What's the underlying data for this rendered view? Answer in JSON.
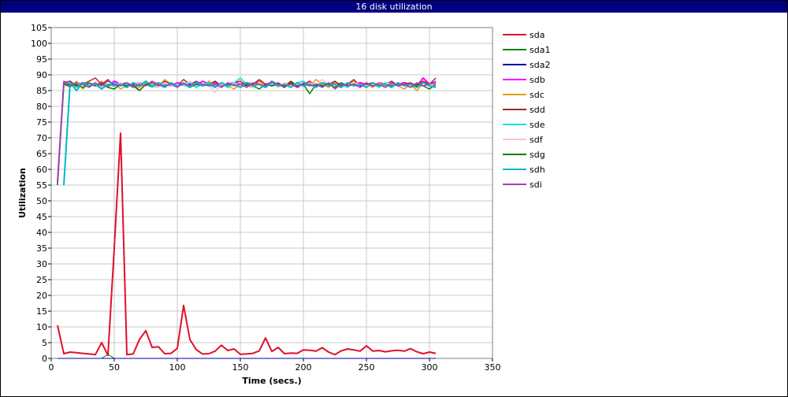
{
  "window": {
    "title": "16 disk utilization"
  },
  "chart_data": {
    "type": "line",
    "title": "16 disk utilization",
    "xlabel": "Time (secs.)",
    "ylabel": "Utilization",
    "xlim": [
      0,
      350
    ],
    "ylim": [
      0,
      105
    ],
    "xticks": [
      0,
      50,
      100,
      150,
      200,
      250,
      300,
      350
    ],
    "yticks": [
      0,
      5,
      10,
      15,
      20,
      25,
      30,
      35,
      40,
      45,
      50,
      55,
      60,
      65,
      70,
      75,
      80,
      85,
      90,
      95,
      100,
      105
    ],
    "grid": true,
    "legend_position": "right",
    "x": [
      5,
      10,
      15,
      20,
      25,
      30,
      35,
      40,
      45,
      50,
      55,
      60,
      65,
      70,
      75,
      80,
      85,
      90,
      95,
      100,
      105,
      110,
      115,
      120,
      125,
      130,
      135,
      140,
      145,
      150,
      155,
      160,
      165,
      170,
      175,
      180,
      185,
      190,
      195,
      200,
      205,
      210,
      215,
      220,
      225,
      230,
      235,
      240,
      245,
      250,
      255,
      260,
      265,
      270,
      275,
      280,
      285,
      290,
      295,
      300,
      305
    ],
    "series": [
      {
        "name": "sda",
        "color": "#e0102a",
        "width": 2,
        "values": [
          10.5,
          1.5,
          2,
          1.8,
          1.6,
          1.4,
          1.2,
          5,
          1,
          35,
          71.5,
          1.2,
          1.4,
          6,
          8.8,
          3.5,
          3.7,
          1.5,
          1.6,
          3.2,
          16.8,
          6,
          2.8,
          1.4,
          1.5,
          2.3,
          4.2,
          2.5,
          3,
          1.3,
          1.4,
          1.6,
          2.4,
          6.5,
          2.2,
          3.5,
          1.5,
          1.7,
          1.6,
          2.7,
          2.6,
          2.3,
          3.4,
          2,
          1.2,
          2.4,
          3,
          2.7,
          2.3,
          4,
          2.3,
          2.5,
          2.1,
          2.4,
          2.6,
          2.3,
          3.1,
          2.1,
          1.5,
          2,
          1.6
        ]
      },
      {
        "name": "sda1",
        "color": "#008000",
        "width": 1,
        "values": [
          0,
          0,
          0,
          0,
          0,
          0,
          0,
          0,
          1.3,
          0,
          0,
          0,
          0,
          0,
          0,
          0,
          0,
          0,
          0,
          0,
          0,
          0,
          0,
          0,
          0,
          0,
          0,
          0,
          0,
          0,
          0,
          0,
          0,
          0,
          0,
          0,
          0,
          0,
          0,
          0,
          0,
          0,
          0,
          0,
          0,
          0,
          0,
          0,
          0,
          0,
          0,
          0,
          0,
          0,
          0,
          0,
          0,
          0,
          0,
          0,
          0
        ]
      },
      {
        "name": "sda2",
        "color": "#0000a0",
        "width": 1,
        "values": [
          0,
          0,
          0,
          0,
          0,
          0,
          0,
          0,
          0,
          0,
          0,
          0,
          0,
          0,
          0,
          0,
          0,
          0,
          0,
          0,
          0,
          0,
          0,
          0,
          0,
          0,
          0,
          0,
          0,
          0,
          0,
          0,
          0,
          0,
          0,
          0,
          0,
          0,
          0,
          0,
          0,
          0,
          0,
          0,
          0,
          0,
          0,
          0,
          0,
          0,
          0,
          0,
          0,
          0,
          0,
          0,
          0,
          0,
          0,
          0,
          0
        ]
      },
      {
        "name": "sdb",
        "color": "#ff00ff",
        "width": 2,
        "values": [
          56,
          87.5,
          87,
          86.5,
          87.5,
          87,
          86.5,
          87.5,
          86.5,
          88,
          87,
          86.5,
          87,
          87.5,
          87,
          86.5,
          87.5,
          87,
          86.5,
          87.5,
          87,
          87,
          86.5,
          88,
          87,
          87.5,
          86.5,
          87,
          87.5,
          87,
          87.5,
          87,
          88,
          87,
          87.5,
          86.5,
          87,
          87.5,
          86,
          87,
          87.5,
          87,
          86.5,
          87,
          87.5,
          87,
          86.5,
          87,
          87.5,
          87,
          86.5,
          87.5,
          87,
          86.5,
          87,
          87.5,
          87,
          86.5,
          89,
          87,
          87.5
        ]
      },
      {
        "name": "sdc",
        "color": "#e0a000",
        "width": 1.5,
        "values": [
          55,
          87,
          86,
          88,
          85.5,
          87,
          86.5,
          88,
          86,
          87.5,
          85.5,
          86.5,
          87,
          86,
          87.5,
          86.5,
          86,
          88.5,
          87,
          86.5,
          87,
          86,
          87.5,
          86.5,
          88,
          86.5,
          87,
          86.5,
          85.5,
          87,
          86.5,
          86,
          88,
          87,
          86.5,
          87,
          86.5,
          88,
          86.5,
          87,
          86.5,
          88.5,
          87,
          86,
          87.5,
          86.5,
          87,
          88,
          86.5,
          87,
          86,
          87.5,
          86.5,
          87,
          86.5,
          85.5,
          87,
          85,
          87.5,
          87,
          86.5
        ]
      },
      {
        "name": "sdd",
        "color": "#a52a2a",
        "width": 1.5,
        "values": [
          55.5,
          87.5,
          88,
          86.5,
          87,
          88,
          89,
          87,
          88.5,
          86.5,
          87,
          87.5,
          86.5,
          85,
          87,
          87.5,
          86.5,
          88,
          87,
          86.5,
          88.5,
          87,
          88,
          86.5,
          87,
          88,
          86.5,
          87,
          87.5,
          88,
          86.5,
          87,
          88.5,
          87,
          86.5,
          87.5,
          86,
          88,
          86.5,
          87,
          88,
          86.5,
          87.5,
          87,
          88,
          86.5,
          87,
          88.5,
          86.5,
          87,
          87.5,
          86.5,
          87,
          88,
          86.5,
          87,
          87.5,
          86.5,
          88,
          87,
          89
        ]
      },
      {
        "name": "sde",
        "color": "#00e0e0",
        "width": 1.5,
        "values": [
          55,
          87,
          87.5,
          86,
          87,
          86.5,
          87.5,
          86,
          87,
          87.5,
          86.5,
          87,
          86,
          87.5,
          87,
          86,
          87.5,
          87,
          86.5,
          87,
          86.5,
          87.5,
          86,
          87,
          87.5,
          86.5,
          87,
          86,
          87.5,
          89,
          87,
          86.5,
          87,
          86,
          87.5,
          86.5,
          87,
          86,
          87.5,
          88,
          86.5,
          87,
          86,
          87.5,
          86.5,
          87,
          86,
          87.5,
          87,
          86.5,
          87,
          86,
          87.5,
          87,
          86.5,
          87,
          86,
          87.5,
          86.5,
          87,
          86.5
        ]
      },
      {
        "name": "sdf",
        "color": "#ffc0cb",
        "width": 1.5,
        "values": [
          55,
          87,
          86.5,
          87.5,
          86,
          87,
          87.5,
          86,
          87,
          86.5,
          87.5,
          86,
          87,
          87.5,
          86.5,
          87,
          86,
          87.5,
          86.5,
          87,
          86.5,
          88,
          86.5,
          87,
          86.5,
          84.5,
          87,
          86.5,
          87.5,
          86.5,
          87,
          86,
          87.5,
          86.5,
          87,
          86,
          87.5,
          86.5,
          87,
          86,
          87.5,
          87,
          88.5,
          87,
          86.5,
          87,
          86.5,
          87.5,
          87,
          86.5,
          87,
          86.5,
          87,
          87.5,
          86.5,
          87,
          86.5,
          87,
          86.5,
          87,
          86.5
        ]
      },
      {
        "name": "sdg",
        "color": "#008000",
        "width": 1.5,
        "values": [
          55,
          87,
          86.5,
          87,
          86,
          87.5,
          86.5,
          87,
          86,
          85.5,
          87,
          86.5,
          87,
          85,
          87,
          86.5,
          87,
          86,
          87.5,
          86.5,
          87,
          86,
          87,
          86.5,
          87,
          86,
          87.5,
          86.5,
          87,
          86,
          87,
          86.5,
          85.5,
          87,
          86.5,
          87,
          86,
          87.5,
          86.5,
          87,
          84,
          87,
          86.5,
          87,
          86,
          87.5,
          86.5,
          87,
          86,
          87.5,
          86.5,
          87,
          86,
          87.5,
          86.5,
          87,
          86,
          87,
          86.5,
          85.5,
          87
        ]
      },
      {
        "name": "sdh",
        "color": "#00b8c8",
        "width": 2,
        "values": [
          null,
          55,
          87.5,
          85,
          87.5,
          86.5,
          87,
          85.5,
          87,
          86.5,
          87,
          86,
          87.5,
          86.5,
          88,
          86.5,
          87,
          86,
          87.5,
          86.5,
          87,
          86,
          87.5,
          86.5,
          87,
          86,
          87.5,
          86.5,
          87,
          86,
          87.5,
          86.5,
          87,
          86,
          87.5,
          86.5,
          87,
          86,
          87.5,
          86.5,
          87,
          86,
          87.5,
          86.5,
          87,
          86,
          87.5,
          86.5,
          87,
          86,
          87.5,
          86.5,
          87,
          86,
          87.5,
          86.5,
          87,
          86,
          87.5,
          86.5,
          86
        ]
      },
      {
        "name": "sdi",
        "color": "#a040c0",
        "width": 1.5,
        "values": [
          55.5,
          88,
          86.5,
          87.5,
          87,
          86,
          87.5,
          86.5,
          88,
          87,
          86.5,
          87.5,
          86,
          87,
          86.5,
          88,
          87,
          86.5,
          87,
          86,
          87.5,
          86.5,
          88,
          87,
          86.5,
          87,
          86,
          87.5,
          86.5,
          87,
          86,
          87.5,
          87,
          86.5,
          88,
          87,
          86.5,
          87,
          86,
          87.5,
          86.5,
          87,
          86,
          87.5,
          85.5,
          87,
          86.5,
          87,
          86,
          87.5,
          86.5,
          87,
          86,
          87.5,
          86.5,
          87,
          86,
          87.5,
          86.5,
          87,
          88
        ]
      }
    ]
  }
}
